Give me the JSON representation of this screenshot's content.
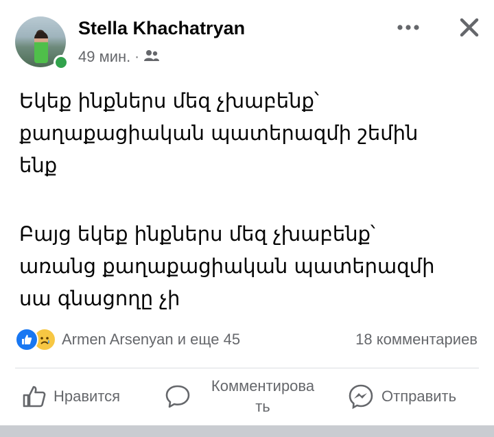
{
  "post": {
    "author": "Stella Khachatryan",
    "time": "49 мин.",
    "separator": "·",
    "audience_icon": "friends-icon",
    "paragraph1": "Եկեք ինքներս մեզ չխաբենք՝\nքաղաքացիական պատերազմի շեմին\nենք",
    "paragraph2": "Բայց եկեք ինքներս մեզ չխաբենք՝\nառանց քաղաքացիական պատերազմի\nսա գնացողը չի"
  },
  "reactions": {
    "icons": [
      "like-icon",
      "sad-icon"
    ],
    "names": "Armen Arsenyan и еще 45",
    "comments": "18 комментариев"
  },
  "actions": {
    "like": "Нравится",
    "comment": "Комментирова\nть",
    "share": "Отправить"
  },
  "colors": {
    "accent": "#1877f2",
    "online": "#31a24c",
    "secondary_text": "#65676b"
  }
}
